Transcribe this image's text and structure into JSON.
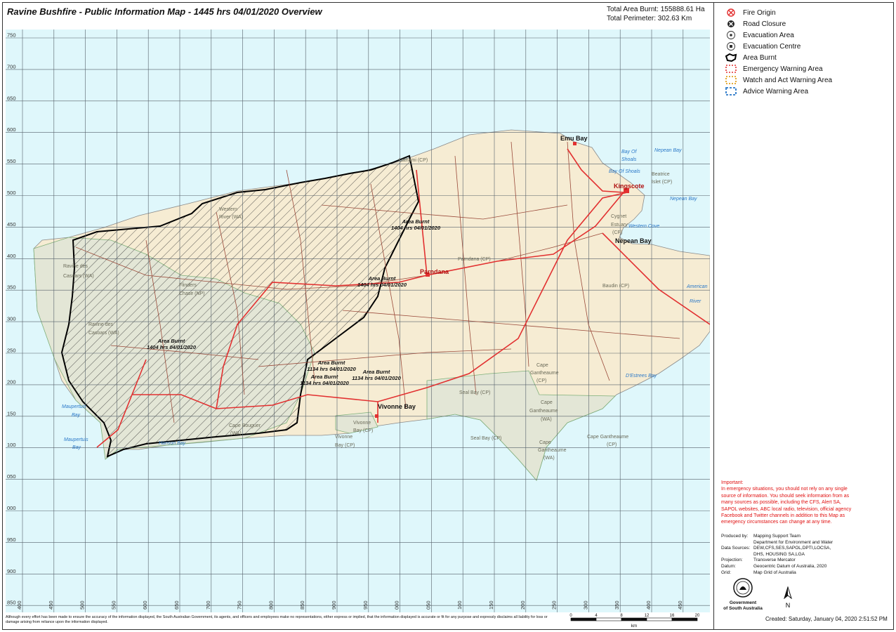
{
  "title": "Ravine Bushfire - Public Information Map - 1445 hrs 04/01/2020 Overview",
  "stats": {
    "area_burnt": "Total Area Burnt: 155888.61 Ha",
    "perimeter": "Total Perimeter: 302.63 Km"
  },
  "legend": [
    {
      "icon": "fire-origin-icon",
      "label": "Fire Origin"
    },
    {
      "icon": "road-closure-icon",
      "label": "Road Closure"
    },
    {
      "icon": "evacuation-area-icon",
      "label": "Evacuation Area"
    },
    {
      "icon": "evacuation-centre-icon",
      "label": "Evacuation Centre"
    },
    {
      "icon": "area-burnt-icon",
      "label": "Area Burnt"
    },
    {
      "icon": "emergency-warning-icon",
      "label": "Emergency Warning Area"
    },
    {
      "icon": "watch-act-icon",
      "label": "Watch and Act Warning Area"
    },
    {
      "icon": "advice-warning-icon",
      "label": "Advice Warning Area"
    }
  ],
  "colors": {
    "sea": "#dff7fb",
    "land": "#f6ecd3",
    "park": "#e3e6d6",
    "road_major": "#e23030",
    "road_minor": "#9a4a3a",
    "burnt": "#000000",
    "important": "#e01010"
  },
  "map": {
    "y_ticks": [
      "750",
      "700",
      "650",
      "600",
      "550",
      "500",
      "450",
      "400",
      "350",
      "300",
      "250",
      "200",
      "150",
      "100",
      "050",
      "000",
      "950",
      "900",
      "850"
    ],
    "x_ticks": [
      "400",
      "450",
      "500",
      "550",
      "600",
      "650",
      "700",
      "750",
      "800",
      "850",
      "900",
      "950",
      "000",
      "050",
      "100",
      "150",
      "200",
      "250",
      "300",
      "350",
      "400",
      "450"
    ],
    "places": [
      {
        "text": "Emu Bay",
        "cls": "town"
      },
      {
        "text": "Kingscote",
        "cls": "towncity"
      },
      {
        "text": "Nepean Bay",
        "cls": "town"
      },
      {
        "text": "Parndana",
        "cls": "towncity"
      },
      {
        "text": "Vivonne Bay",
        "cls": "town"
      },
      {
        "text": "Nepean Bay",
        "cls": "water"
      },
      {
        "text": "Nepean Bay",
        "cls": "water"
      },
      {
        "text": "Bay Of",
        "cls": "water"
      },
      {
        "text": "Shoals",
        "cls": "water"
      },
      {
        "text": "Bay Of Shoals",
        "cls": "water"
      },
      {
        "text": "Western Cove",
        "cls": "water"
      },
      {
        "text": "American",
        "cls": "water"
      },
      {
        "text": "River",
        "cls": "water"
      },
      {
        "text": "D'Estrees Bay",
        "cls": "water"
      },
      {
        "text": "Maupertuis",
        "cls": "water"
      },
      {
        "text": "Bay",
        "cls": "water"
      },
      {
        "text": "Maupertuis",
        "cls": "water"
      },
      {
        "text": "Bay",
        "cls": "water"
      },
      {
        "text": "Hanson Bay",
        "cls": "water"
      },
      {
        "text": "Beatrice",
        "cls": "park"
      },
      {
        "text": "Islet (CP)",
        "cls": "park"
      },
      {
        "text": "Cygnet",
        "cls": "park"
      },
      {
        "text": "Estuary",
        "cls": "park"
      },
      {
        "text": "(CP)",
        "cls": "park"
      },
      {
        "text": "Lathami (CP)",
        "cls": "park"
      },
      {
        "text": "Parndana (CP)",
        "cls": "park"
      },
      {
        "text": "Baudin (CP)",
        "cls": "park"
      },
      {
        "text": "Ravine des",
        "cls": "park"
      },
      {
        "text": "Casoars (WA)",
        "cls": "park"
      },
      {
        "text": "Ravine des",
        "cls": "park"
      },
      {
        "text": "Casoars (WA)",
        "cls": "park"
      },
      {
        "text": "Flinders",
        "cls": "park"
      },
      {
        "text": "Chase (NP)",
        "cls": "park"
      },
      {
        "text": "Western",
        "cls": "park"
      },
      {
        "text": "River (WA)",
        "cls": "park"
      },
      {
        "text": "Cape",
        "cls": "park"
      },
      {
        "text": "Gantheaume",
        "cls": "park"
      },
      {
        "text": "(CP)",
        "cls": "park"
      },
      {
        "text": "Seal Bay (CP)",
        "cls": "park"
      },
      {
        "text": "Cape",
        "cls": "park"
      },
      {
        "text": "Gantheaume",
        "cls": "park"
      },
      {
        "text": "(WA)",
        "cls": "park"
      },
      {
        "text": "Seal Bay (CP)",
        "cls": "park"
      },
      {
        "text": "Cape",
        "cls": "park"
      },
      {
        "text": "Gantheaume",
        "cls": "park"
      },
      {
        "text": "(WA)",
        "cls": "park"
      },
      {
        "text": "Cape Gantheaume",
        "cls": "park"
      },
      {
        "text": "(CP)",
        "cls": "park"
      },
      {
        "text": "Cape Bouguer",
        "cls": "park"
      },
      {
        "text": "(WA)",
        "cls": "park"
      },
      {
        "text": "Vivonne",
        "cls": "park"
      },
      {
        "text": "Bay (CP)",
        "cls": "park"
      },
      {
        "text": "Vivonne",
        "cls": "park"
      },
      {
        "text": "Bay (CP)",
        "cls": "park"
      }
    ],
    "burn_labels": [
      {
        "line1": "Area Burnt",
        "line2": "1404 hrs 04/01/2020"
      },
      {
        "line1": "Area Burnt",
        "line2": "1404 hrs 04/01/2020"
      },
      {
        "line1": "Area Burnt",
        "line2": "1404 hrs 04/01/2020"
      },
      {
        "line1": "Area Burnt",
        "line2": "1134 hrs 04/01/2020"
      },
      {
        "line1": "Area Burnt",
        "line2": "1134 hrs 04/01/2020"
      },
      {
        "line1": "Area Burnt",
        "line2": "1134 hrs 04/01/2020"
      }
    ]
  },
  "important": {
    "heading": "Important:",
    "text": "In emergency situations, you should not rely on any single source of information. You should seek information from as many sources as possible, including the CFS, Alert SA, SAPOL websites, ABC local radio, television, official agency Facebook and Twitter channels in addition to this Map as emergency circumstances can change at any time."
  },
  "credits": [
    {
      "k": "Produced by:",
      "v": "Mapping Support Team"
    },
    {
      "k": "",
      "v": "Department for Environment and Water"
    },
    {
      "k": "Data Sources:",
      "v": "DEW,CFS,SES,SAPOL,DPTI,LOCSA,"
    },
    {
      "k": "",
      "v": "DHS, HOUSING SA,LGA"
    },
    {
      "k": "Projection:",
      "v": "Transverse Mercator"
    },
    {
      "k": "Datum:",
      "v": "Geocentric Datum of Australia, 2020"
    },
    {
      "k": "Grid:",
      "v": "Map Grid of Australia"
    }
  ],
  "gov": {
    "line1": "Government",
    "line2": "of South Australia"
  },
  "north": "N",
  "scale": {
    "ticks": [
      "0",
      "4",
      "8",
      "12",
      "16",
      "20"
    ],
    "unit": "km"
  },
  "created": "Created: Saturday, January 04, 2020 2:51:52 PM",
  "disclaimer": "Although every effort has been made to ensure the accuracy of the information displayed, the South Australian Government, its agents, and officers and employees make no representations, either express or implied, that the information displayed is accurate or fit for any purpose and expressly disclaims all liability for loss or damage arising from reliance upon the information displayed."
}
